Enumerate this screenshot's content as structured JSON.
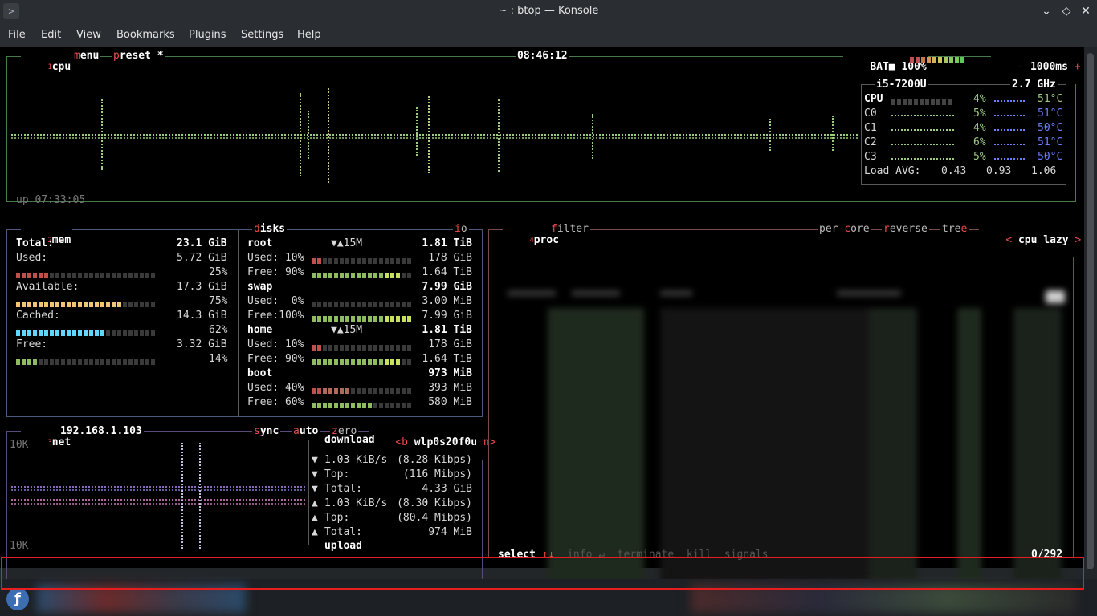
{
  "window": {
    "title": "~ : btop — Konsole",
    "buttons": [
      "⌄",
      "◇",
      "✕"
    ]
  },
  "menu": [
    "File",
    "Edit",
    "View",
    "Bookmarks",
    "Plugins",
    "Settings",
    "Help"
  ],
  "cpu_box": {
    "num": "1",
    "title": "cpu",
    "menu_hotkey": "m",
    "menu_rest": "enu",
    "preset_hotkey": "p",
    "preset_rest": "reset *",
    "clock": "08:46:12",
    "battery_label": "BAT■",
    "battery_pct": "100%",
    "interval_minus": "-",
    "interval": "1000ms",
    "interval_plus": "+",
    "uptime": "up 07:33:05",
    "model": "i5-7200U",
    "freq": "2.7 GHz",
    "rows": [
      {
        "name": "CPU",
        "pct": "4%",
        "temp": "51°C"
      },
      {
        "name": "C0",
        "pct": "5%",
        "temp": "51°C"
      },
      {
        "name": "C1",
        "pct": "4%",
        "temp": "50°C"
      },
      {
        "name": "C2",
        "pct": "6%",
        "temp": "51°C"
      },
      {
        "name": "C3",
        "pct": "5%",
        "temp": "50°C"
      }
    ],
    "load_label": "Load AVG:",
    "load": [
      "0.43",
      "0.93",
      "1.06"
    ]
  },
  "mem_box": {
    "num": "2",
    "title": "mem",
    "rows": [
      {
        "label": "Total:",
        "value": "23.1 GiB",
        "pct": ""
      },
      {
        "label": "Used:",
        "value": "5.72 GiB",
        "pct": "25%",
        "level": 0.25,
        "color": "#c0504d"
      },
      {
        "label": "Available:",
        "value": "17.3 GiB",
        "pct": "75%",
        "level": 0.75,
        "color": "#f0c674"
      },
      {
        "label": "Cached:",
        "value": "14.3 GiB",
        "pct": "62%",
        "level": 0.62,
        "color": "#5fd7ff"
      },
      {
        "label": "Free:",
        "value": "3.32 GiB",
        "pct": "14%",
        "level": 0.14,
        "color": "#8fbc5f"
      }
    ]
  },
  "disks_box": {
    "title_hotkey": "d",
    "title_rest": "isks",
    "io_hotkey": "i",
    "io_rest": "o",
    "disks": [
      {
        "name": "root",
        "io": "▼▲15M",
        "size": "1.81 TiB",
        "used_label": "Used: 10%",
        "used": "178 GiB",
        "used_level": 0.1,
        "free_label": "Free: 90%",
        "free": "1.64 TiB",
        "free_level": 0.9
      },
      {
        "name": "swap",
        "io": "",
        "size": "7.99 GiB",
        "used_label": "Used:  0%",
        "used": "3.00 MiB",
        "used_level": 0.0,
        "free_label": "Free:100%",
        "free": "7.99 GiB",
        "free_level": 1.0
      },
      {
        "name": "home",
        "io": "▼▲15M",
        "size": "1.81 TiB",
        "used_label": "Used: 10%",
        "used": "178 GiB",
        "used_level": 0.1,
        "free_label": "Free: 90%",
        "free": "1.64 TiB",
        "free_level": 0.9
      },
      {
        "name": "boot",
        "io": "",
        "size": "973 MiB",
        "used_label": "Used: 40%",
        "used": "393 MiB",
        "used_level": 0.4,
        "free_label": "Free: 60%",
        "free": "580 MiB",
        "free_level": 0.6
      }
    ]
  },
  "net_box": {
    "num": "3",
    "title": "net",
    "ip": "192.168.1.103",
    "sync_hotkey": "s",
    "sync_rest": "ync",
    "auto_hotkey": "a",
    "auto_rest": "uto",
    "zero_hotkey": "z",
    "zero_rest": "ero",
    "iface_prev": "<b",
    "iface": "wlp0s20f0u",
    "iface_next": "n>",
    "scale_top": "10K",
    "scale_bottom": "10K",
    "download_label": "download",
    "upload_label": "upload",
    "rows": [
      {
        "arrow": "▼",
        "label": "1.03 KiB/s",
        "value": "(8.28 Kibps)"
      },
      {
        "arrow": "▼",
        "label": "Top:",
        "value": "(116 Mibps)"
      },
      {
        "arrow": "▼",
        "label": "Total:",
        "value": "4.33 GiB"
      },
      {
        "arrow": "▲",
        "label": "1.03 KiB/s",
        "value": "(8.30 Kibps)"
      },
      {
        "arrow": "▲",
        "label": "Top:",
        "value": "(80.4 Mibps)"
      },
      {
        "arrow": "▲",
        "label": "Total:",
        "value": "974 MiB"
      }
    ]
  },
  "proc_box": {
    "num": "4",
    "title": "proc",
    "filter_hotkey": "f",
    "filter_rest": "ilter",
    "percore_a": "per-",
    "percore_hotkey": "c",
    "percore_b": "ore",
    "reverse_hotkey": "r",
    "reverse_rest": "everse",
    "tree_a": "tre",
    "tree_hotkey": "e",
    "sort_prev": "<",
    "sort": "cpu lazy",
    "sort_next": ">",
    "select_label": "select",
    "select_arrows": "↑↓",
    "info_label": "info",
    "info_key": "↵",
    "terminate_label": "terminate",
    "kill_label": "kill",
    "signals_label": "signals",
    "count": "0/292"
  }
}
